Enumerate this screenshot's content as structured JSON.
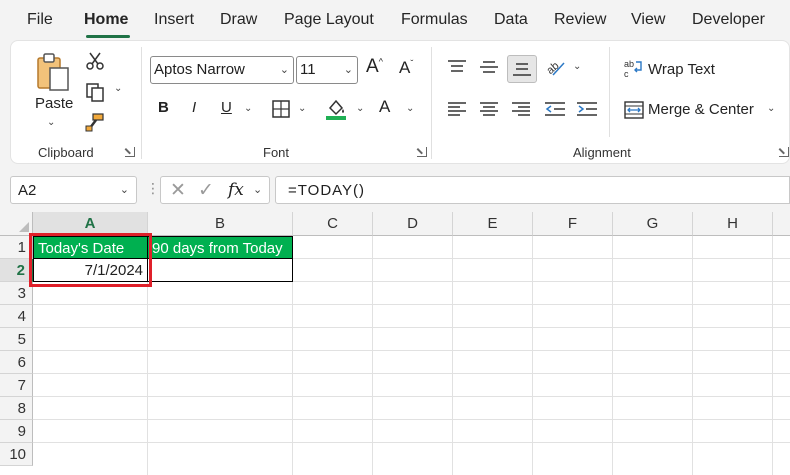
{
  "tabs": [
    "File",
    "Home",
    "Insert",
    "Draw",
    "Page Layout",
    "Formulas",
    "Data",
    "Review",
    "View",
    "Developer"
  ],
  "active_tab": "Home",
  "ribbon": {
    "clipboard": {
      "paste_label": "Paste",
      "group_label": "Clipboard"
    },
    "font": {
      "font_name": "Aptos Narrow",
      "font_size": "11",
      "group_label": "Font"
    },
    "alignment": {
      "wrap_text": "Wrap Text",
      "merge_center": "Merge & Center",
      "group_label": "Alignment"
    }
  },
  "formula_bar": {
    "name_box": "A2",
    "fx": "fx",
    "formula": "=TODAY()"
  },
  "sheet": {
    "columns": [
      "A",
      "B",
      "C",
      "D",
      "E",
      "F",
      "G",
      "H"
    ],
    "rows": [
      "1",
      "2",
      "3",
      "4",
      "5",
      "6",
      "7",
      "8",
      "9",
      "10"
    ],
    "cells": {
      "A1": "Today's Date",
      "B1": "90 days from Today",
      "A2": "7/1/2024",
      "B2": ""
    },
    "header_fill": "#00b050",
    "header_text_color": "#ffffff",
    "highlight_color": "#e0202a"
  }
}
